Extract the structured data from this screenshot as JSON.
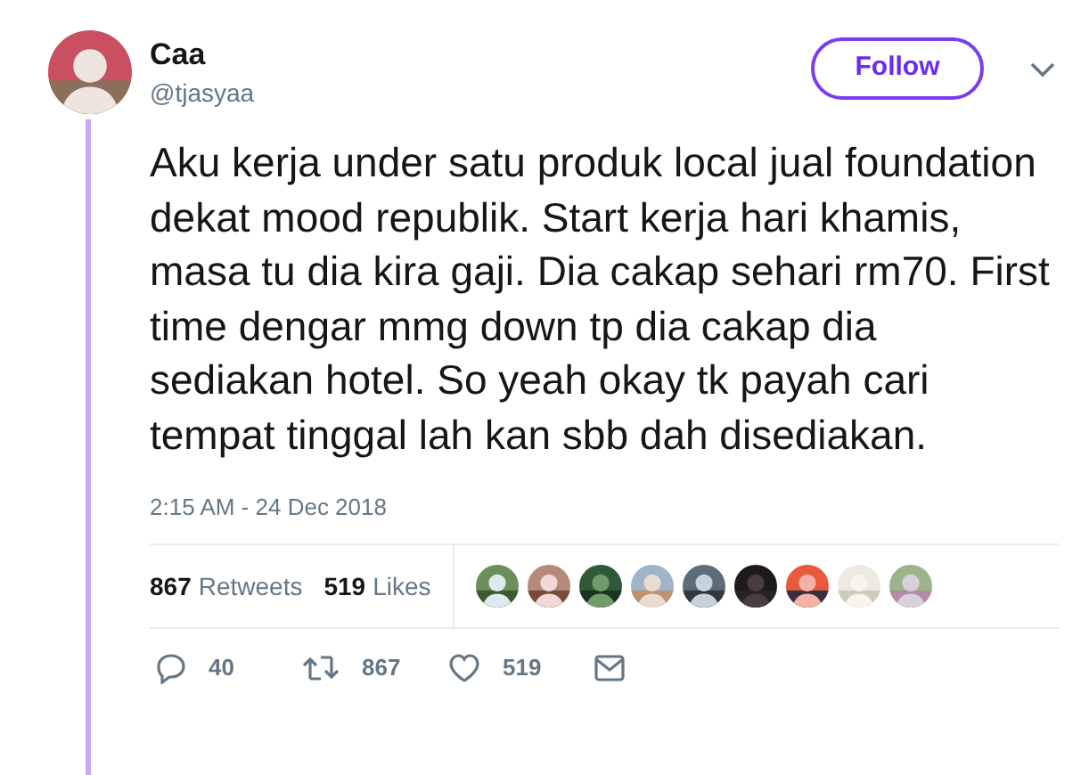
{
  "author": {
    "name": "Caa",
    "handle": "@tjasyaa"
  },
  "follow_button": {
    "label": "Follow"
  },
  "tweet": {
    "text": "Aku kerja under satu produk local jual foundation dekat mood republik. Start kerja hari khamis, masa tu dia kira gaji. Dia cakap sehari rm70. First time dengar mmg down tp dia cakap dia sediakan hotel. So yeah okay tk payah cari tempat tinggal lah kan sbb dah disediakan.",
    "timestamp": "2:15 AM - 24 Dec 2018"
  },
  "stats": [
    {
      "count": "867",
      "label": "Retweets"
    },
    {
      "count": "519",
      "label": "Likes"
    }
  ],
  "actions": [
    {
      "kind": "reply",
      "count": "40"
    },
    {
      "kind": "retweet",
      "count": "867"
    },
    {
      "kind": "like",
      "count": "519"
    },
    {
      "kind": "message"
    }
  ]
}
